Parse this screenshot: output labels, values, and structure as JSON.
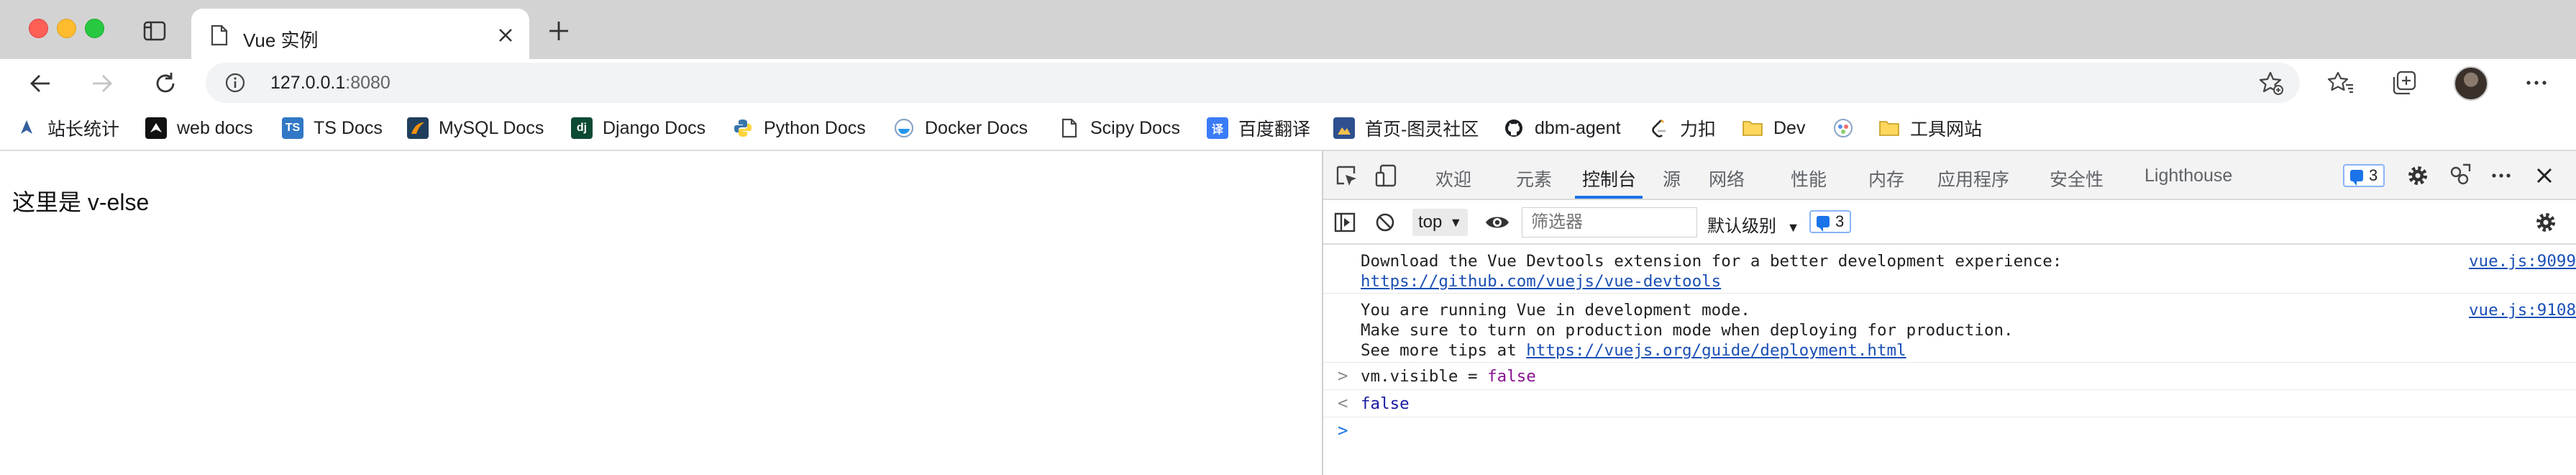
{
  "browser": {
    "tab_title": "Vue 实例",
    "url_host": "127.0.0.1",
    "url_port": ":8080"
  },
  "bookmarks": [
    {
      "label": "站长统计",
      "icon": "rocket-icon"
    },
    {
      "label": "web docs",
      "icon": "mdn-icon"
    },
    {
      "label": "TS Docs",
      "icon": "ts-icon"
    },
    {
      "label": "MySQL Docs",
      "icon": "mysql-icon"
    },
    {
      "label": "Django Docs",
      "icon": "django-icon"
    },
    {
      "label": "Python Docs",
      "icon": "python-icon"
    },
    {
      "label": "Docker Docs",
      "icon": "docker-icon"
    },
    {
      "label": "Scipy Docs",
      "icon": "document-icon"
    },
    {
      "label": "百度翻译",
      "icon": "translate-icon"
    },
    {
      "label": "首页-图灵社区",
      "icon": "turing-icon"
    },
    {
      "label": "dbm-agent",
      "icon": "github-icon"
    },
    {
      "label": "力扣",
      "icon": "leetcode-icon"
    },
    {
      "label": "Dev",
      "icon": "folder-icon"
    },
    {
      "label": "",
      "icon": "app-icon"
    },
    {
      "label": "工具网站",
      "icon": "folder-icon"
    }
  ],
  "page": {
    "text": "这里是 v-else"
  },
  "devtools": {
    "tabs": [
      "欢迎",
      "元素",
      "控制台",
      "源",
      "网络",
      "性能",
      "内存",
      "应用程序",
      "安全性",
      "Lighthouse"
    ],
    "active_tab": "控制台",
    "issues_count": "3",
    "context": "top",
    "filter_placeholder": "筛选器",
    "level_label": "默认级别",
    "messages_count": "3",
    "messages": [
      {
        "lines": [
          "Download the Vue Devtools extension for a better development experience:"
        ],
        "link": "https://github.com/vuejs/vue-devtools",
        "source": "vue.js:9099"
      },
      {
        "lines": [
          "You are running Vue in development mode.",
          "Make sure to turn on production mode when deploying for production."
        ],
        "prefix": "See more tips at ",
        "link": "https://vuejs.org/guide/deployment.html",
        "source": "vue.js:9108"
      }
    ],
    "input_expr": "vm.visible = ",
    "input_value": "false",
    "result": "false"
  }
}
